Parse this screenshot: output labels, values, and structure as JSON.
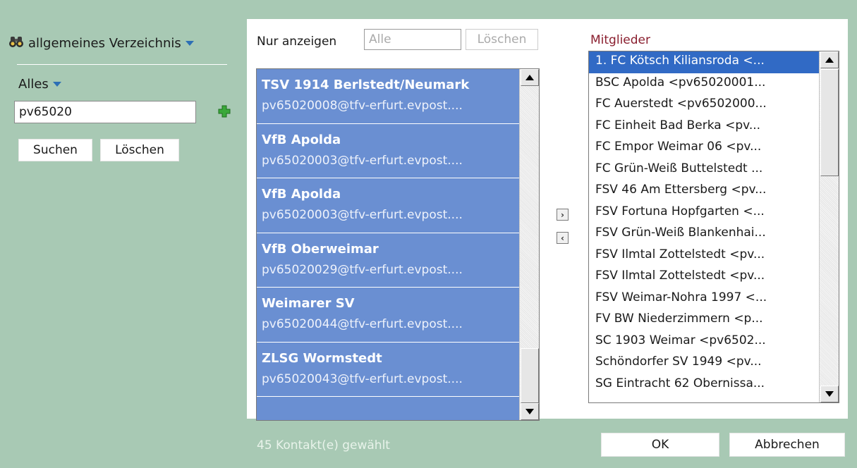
{
  "sidebar": {
    "directory_label": "allgemeines Verzeichnis",
    "scope_label": "Alles",
    "search_value": "pv65020",
    "search_button": "Suchen",
    "clear_button": "Löschen"
  },
  "filter": {
    "label": "Nur anzeigen",
    "placeholder": "Alle",
    "clear_button": "Löschen"
  },
  "contacts": [
    {
      "name": "TSV 1914 Berlstedt/Neumark",
      "email": "pv65020008@tfv-erfurt.evpost...."
    },
    {
      "name": "VfB Apolda",
      "email": "pv65020003@tfv-erfurt.evpost...."
    },
    {
      "name": "VfB Apolda",
      "email": "pv65020003@tfv-erfurt.evpost...."
    },
    {
      "name": "VfB Oberweimar",
      "email": "pv65020029@tfv-erfurt.evpost...."
    },
    {
      "name": "Weimarer SV",
      "email": "pv65020044@tfv-erfurt.evpost...."
    },
    {
      "name": "ZLSG Wormstedt",
      "email": "pv65020043@tfv-erfurt.evpost...."
    }
  ],
  "members": {
    "label": "Mitglieder",
    "items": [
      "1. FC Kötsch Kiliansroda <...",
      "BSC Apolda <pv65020001...",
      "FC Auerstedt <pv6502000...",
      "FC Einheit Bad Berka <pv...",
      "FC Empor Weimar 06 <pv...",
      "FC Grün-Weiß Buttelstedt ...",
      "FSV 46 Am Ettersberg <pv...",
      "FSV Fortuna Hopfgarten <...",
      "FSV Grün-Weiß Blankenhai...",
      "FSV Ilmtal Zottelstedt <pv...",
      "FSV Ilmtal Zottelstedt <pv...",
      "FSV Weimar-Nohra 1997 <...",
      "FV BW Niederzimmern <p...",
      "SC 1903 Weimar <pv6502...",
      "Schöndorfer SV 1949 <pv...",
      "SG Eintracht 62 Obernissa..."
    ],
    "selected_index": 0
  },
  "footer": {
    "selection_count": "45 Kontakt(e) gewählt",
    "ok_button": "OK",
    "cancel_button": "Abbrechen"
  },
  "colors": {
    "background": "#a8c9b4",
    "contact_selection": "#6a8fd2",
    "member_selection": "#316ac5",
    "members_label": "#8a1f2f",
    "accent_icon": "#2d6fb5",
    "add_icon": "#3aa83a"
  },
  "icons": {
    "directory": "binoculars-icon",
    "add": "plus-icon",
    "dropdown": "caret-down-icon"
  }
}
